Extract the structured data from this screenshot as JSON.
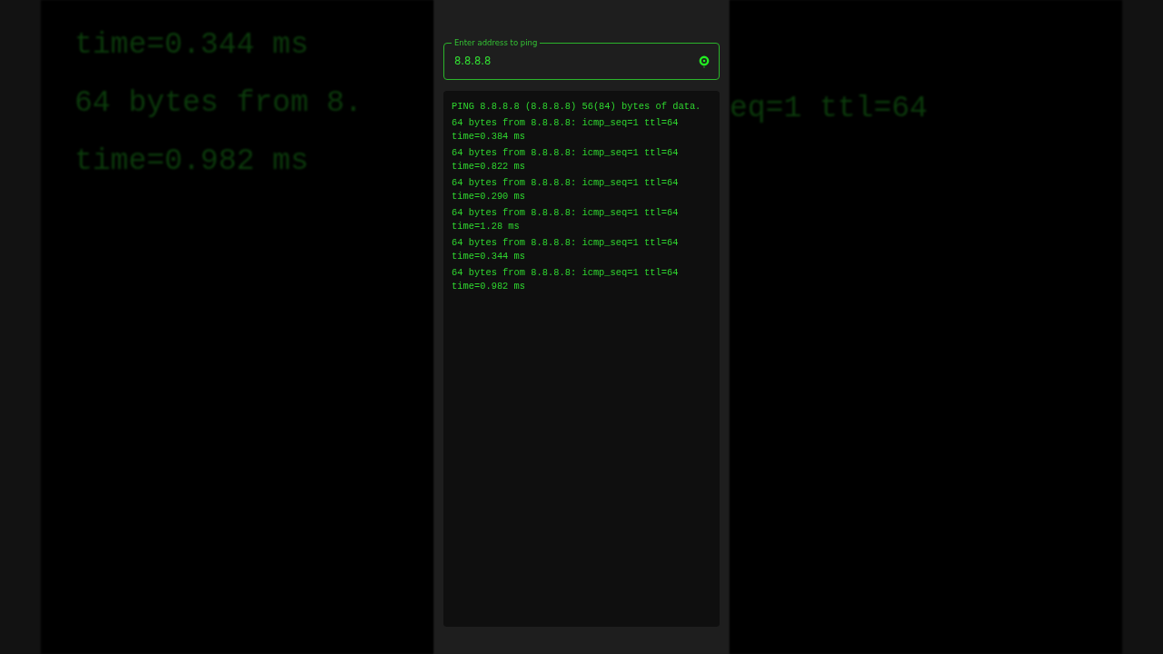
{
  "backdrop": {
    "left_lines": [
      "time=0.344 ms",
      "64 bytes from 8.",
      "time=0.982 ms"
    ],
    "right_lines": [
      "eq=1 ttl=64"
    ]
  },
  "address_field": {
    "label": "Enter address to ping",
    "value": "8.8.8.8"
  },
  "output": [
    "PING 8.8.8.8 (8.8.8.8) 56(84) bytes of data.",
    "64 bytes from 8.8.8.8: icmp_seq=1 ttl=64 time=0.384 ms",
    "64 bytes from 8.8.8.8: icmp_seq=1 ttl=64 time=0.822 ms",
    "64 bytes from 8.8.8.8: icmp_seq=1 ttl=64 time=0.290 ms",
    "64 bytes from 8.8.8.8: icmp_seq=1 ttl=64 time=1.28 ms",
    "64 bytes from 8.8.8.8: icmp_seq=1 ttl=64 time=0.344 ms",
    "64 bytes from 8.8.8.8: icmp_seq=1 ttl=64 time=0.982 ms"
  ]
}
